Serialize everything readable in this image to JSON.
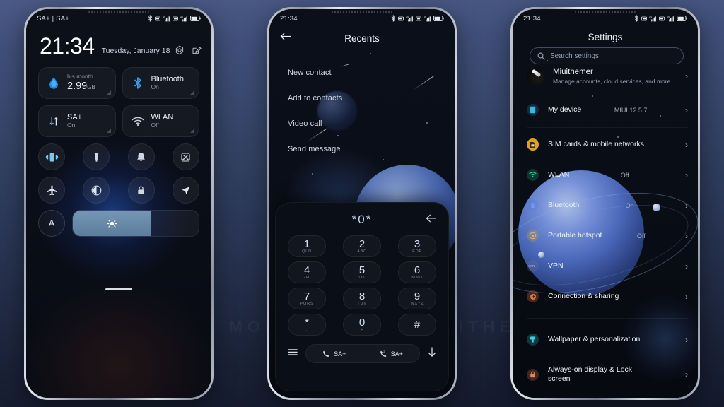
{
  "watermark": "VISIT  FOR  MORE  THEMES   MIUITHEMER.COM",
  "phone1": {
    "statusbar": {
      "left": "SA+ | SA+",
      "time": ""
    },
    "clock": {
      "time": "21:34",
      "date": "Tuesday, January 18"
    },
    "header_icons": [
      {
        "name": "settings-gear-icon"
      },
      {
        "name": "edit-icon"
      }
    ],
    "tiles": [
      {
        "name": "data-usage-tile",
        "sub": "his month",
        "value": "2.99",
        "unit": "GB",
        "icon": "water-drop-icon"
      },
      {
        "name": "bluetooth-tile",
        "title": "Bluetooth",
        "state": "On",
        "icon": "bluetooth-icon"
      },
      {
        "name": "mobile-data-tile",
        "title": "SA+",
        "state": "On",
        "icon": "data-arrows-icon"
      },
      {
        "name": "wlan-tile",
        "title": "WLAN",
        "state": "Off",
        "icon": "wifi-icon"
      }
    ],
    "circle_toggles": [
      {
        "name": "vibrate-toggle",
        "icon": "vibrate-icon"
      },
      {
        "name": "flashlight-toggle",
        "icon": "flashlight-icon"
      },
      {
        "name": "ringer-toggle",
        "icon": "bell-icon"
      },
      {
        "name": "screenshot-toggle",
        "icon": "screenshot-scissors-icon"
      },
      {
        "name": "airplane-toggle",
        "icon": "airplane-icon"
      },
      {
        "name": "dark-mode-toggle",
        "icon": "contrast-circle-icon"
      },
      {
        "name": "lock-toggle",
        "icon": "lock-icon"
      },
      {
        "name": "location-toggle",
        "icon": "location-arrow-icon"
      }
    ],
    "brightness": {
      "auto_label": "A",
      "level_percent": 62,
      "icon": "sun-icon"
    }
  },
  "phone2": {
    "statusbar": {
      "time": "21:34"
    },
    "title": "Recents",
    "back_icon": "arrow-left-icon",
    "menu_items": [
      "New contact",
      "Add to contacts",
      "Video call",
      "Send message"
    ],
    "dialer": {
      "number": "*0*",
      "delete_icon": "backspace-arrow-icon",
      "keys": [
        {
          "digit": "1",
          "letters": "QLD"
        },
        {
          "digit": "2",
          "letters": "ABC"
        },
        {
          "digit": "3",
          "letters": "EDF"
        },
        {
          "digit": "4",
          "letters": "GHI"
        },
        {
          "digit": "5",
          "letters": "JKL"
        },
        {
          "digit": "6",
          "letters": "MNO"
        },
        {
          "digit": "7",
          "letters": "PQRS"
        },
        {
          "digit": "8",
          "letters": "TUV"
        },
        {
          "digit": "9",
          "letters": "WXYZ"
        },
        {
          "digit": "*",
          "letters": ","
        },
        {
          "digit": "0",
          "letters": "+"
        },
        {
          "digit": "#",
          "letters": ""
        }
      ],
      "bottom": {
        "menu_icon": "hamburger-menu-icon",
        "sim1_label": "SA+",
        "sim2_label": "SA+",
        "collapse_icon": "arrow-down-icon"
      }
    }
  },
  "phone3": {
    "statusbar": {
      "time": "21:34"
    },
    "title": "Settings",
    "search": {
      "placeholder": "Search settings",
      "icon": "search-icon"
    },
    "account": {
      "name": "Miuithemer",
      "subtitle": "Manage accounts, cloud services, and more"
    },
    "items": [
      {
        "name": "my-device",
        "label": "My device",
        "value": "MIUI 12.5.7",
        "icon": "device-icon",
        "color": "#3aa6d8"
      },
      {
        "name": "sim-cards",
        "label": "SIM cards & mobile networks",
        "value": "",
        "icon": "sim-icon",
        "color": "#d9a12a"
      },
      {
        "name": "wlan",
        "label": "WLAN",
        "value": "Off",
        "icon": "wifi-icon",
        "color": "#2bbd8a"
      },
      {
        "name": "bluetooth",
        "label": "Bluetooth",
        "value": "On",
        "icon": "bluetooth-icon",
        "color": "#4a7be0"
      },
      {
        "name": "portable-hotspot",
        "label": "Portable hotspot",
        "value": "Off",
        "icon": "hotspot-icon",
        "color": "#e0a832"
      },
      {
        "name": "vpn",
        "label": "VPN",
        "value": "",
        "icon": "vpn-icon",
        "color": "#6a77a8"
      },
      {
        "name": "connection-sharing",
        "label": "Connection & sharing",
        "value": "",
        "icon": "share-icon",
        "color": "#e06b3a"
      },
      {
        "name": "wallpaper-personalization",
        "label": "Wallpaper & personalization",
        "value": "",
        "icon": "brush-icon",
        "color": "#2fb4c4"
      },
      {
        "name": "always-on-display",
        "label": "Always-on display & Lock screen",
        "value": "",
        "icon": "lock-screen-icon",
        "color": "#d4714a"
      }
    ],
    "chevron": "›"
  }
}
